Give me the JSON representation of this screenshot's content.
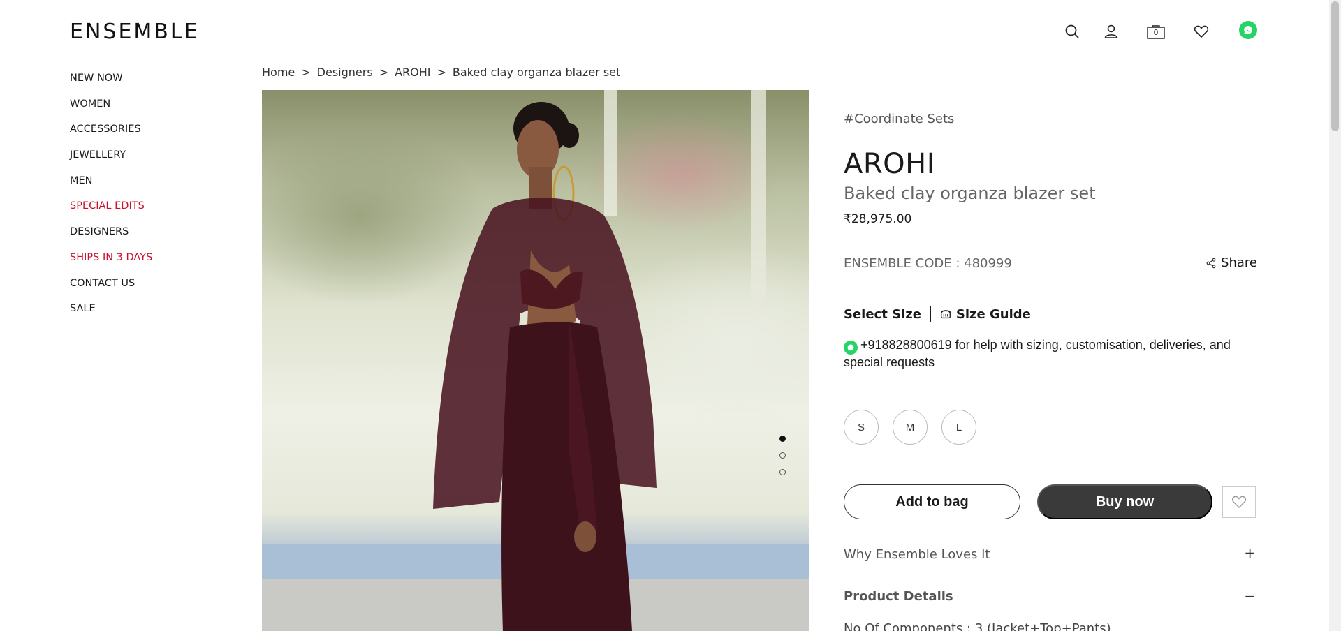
{
  "header": {
    "logo": "ENSEMBLE",
    "bag_count": "0",
    "icons": [
      "search-icon",
      "user-icon",
      "bag-icon",
      "heart-icon",
      "whatsapp-icon"
    ]
  },
  "nav": {
    "items": [
      {
        "label": "NEW NOW",
        "highlight": false
      },
      {
        "label": "WOMEN",
        "highlight": false
      },
      {
        "label": "ACCESSORIES",
        "highlight": false
      },
      {
        "label": "JEWELLERY",
        "highlight": false
      },
      {
        "label": "MEN",
        "highlight": false
      },
      {
        "label": "SPECIAL EDITS",
        "highlight": true
      },
      {
        "label": "DESIGNERS",
        "highlight": false
      },
      {
        "label": "SHIPS IN 3 DAYS",
        "highlight": true
      },
      {
        "label": "CONTACT US",
        "highlight": false
      },
      {
        "label": "SALE",
        "highlight": false
      }
    ]
  },
  "breadcrumb": {
    "items": [
      "Home",
      "Designers",
      "AROHI",
      "Baked clay organza blazer set"
    ],
    "separator": ">"
  },
  "gallery": {
    "image_count": 3,
    "active_index": 0
  },
  "product": {
    "category": "#Coordinate Sets",
    "brand": "AROHI",
    "name": "Baked clay organza blazer set",
    "price": "₹28,975.00",
    "code": "ENSEMBLE CODE : 480999",
    "share_label": "Share",
    "select_size_label": "Select Size",
    "size_guide_label": "Size Guide",
    "help_text": "+918828800619 for help with sizing, customisation, deliveries, and special requests",
    "sizes": [
      "S",
      "M",
      "L"
    ],
    "add_to_bag_label": "Add to bag",
    "buy_now_label": "Buy now",
    "accordion": [
      {
        "title": "Why Ensemble Loves It",
        "toggle": "+"
      },
      {
        "title": "Product Details",
        "toggle": "−"
      }
    ],
    "components": "No Of Components : 3 (Jacket+Top+Pants)"
  },
  "colors": {
    "accent_red": "#c8102e",
    "buy_now_bg": "#3a3a3a",
    "whatsapp": "#25d366"
  }
}
